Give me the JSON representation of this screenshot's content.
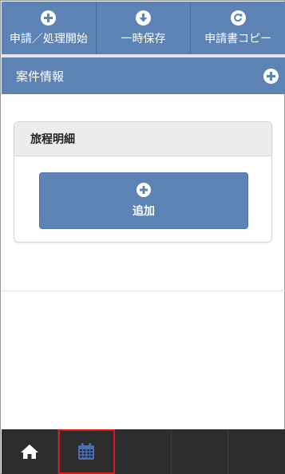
{
  "toolbar": {
    "buttons": [
      {
        "label": "申請／処理開始",
        "icon": "plus-circle-icon"
      },
      {
        "label": "一時保存",
        "icon": "arrow-down-circle-icon"
      },
      {
        "label": "申請書コピー",
        "icon": "refresh-circle-icon"
      }
    ]
  },
  "section": {
    "title": "案件情報",
    "icon": "plus-circle-icon"
  },
  "card": {
    "title": "旅程明細",
    "add_label": "追加"
  },
  "bottom_nav": {
    "items": [
      {
        "icon": "home-icon"
      },
      {
        "icon": "calendar-icon",
        "selected": true
      },
      {
        "icon": ""
      },
      {
        "icon": ""
      },
      {
        "icon": ""
      }
    ]
  },
  "colors": {
    "primary": "#5d83b4",
    "nav_bg": "#2c2c2c",
    "highlight": "#e0141f",
    "calendar": "#4a6fb5"
  }
}
